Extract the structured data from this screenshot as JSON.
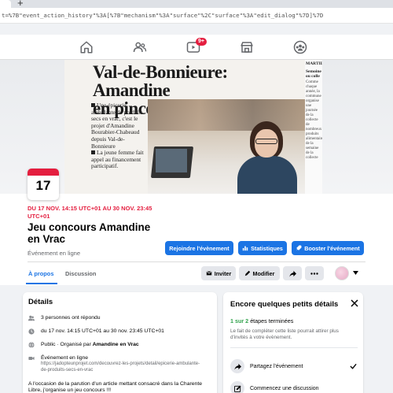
{
  "browser": {
    "new_tab": "+",
    "url": "t=%7B\"event_action_history\"%3A[%7B\"mechanism\"%3A\"surface\"%2C\"surface\"%3A\"edit_dialog\"%7D]%7D"
  },
  "fb_nav": {
    "items": [
      "home-icon",
      "friends-icon",
      "watch-icon",
      "marketplace-icon",
      "groups-icon"
    ],
    "watch_badge": "9+"
  },
  "cover": {
    "headline_line1": "Val-de-Bonnieure: Amandine",
    "headline_line2": "en pince pour le vrac",
    "caption": "Une épicerie ambulante de produits secs en vrac, c'est le projet d'Amandine Bourabier-Chabeaud depuis Val-de-Bonnieure",
    "caption2": "La jeune femme fait appel au financement participatif.",
    "side_head": "MARTIL",
    "side_head2": "Semoine ou colle",
    "side_text": "Comme chaque année, la commune organise une journée de la collecte de nombreux produits alimentaires de la semaine de la collecte"
  },
  "event": {
    "day": "17",
    "date_line": "DU 17 NOV. 14:15 UTC+01 AU 30 NOV. 23:45 UTC+01",
    "title": "Jeu concours Amandine en Vrac",
    "subtitle": "Événement en ligne"
  },
  "actions": {
    "join": "Rejoindre l'évènement",
    "stats": "Statistiques",
    "boost": "Booster l'événement",
    "invite": "Inviter",
    "edit": "Modifier"
  },
  "tabs": {
    "about": "À propos",
    "discussion": "Discussion"
  },
  "details": {
    "title": "Détails",
    "responded": "3 personnes ont répondu",
    "dates": "du 17 nov. 14:15 UTC+01 au 30 nov. 23:45 UTC+01",
    "public_prefix": "Public · Organisé par",
    "organizer": "Amandine en Vrac",
    "online_label": "Événement en ligne",
    "online_url": "https://jadopteunprojet.com/decouvrez-les-projets/detail/epicerie-ambulante-de-produits-secs-en-vrac",
    "description": "A l'occasion de la parution d'un article mettant consacré dans la Charente Libre, j'organise un jeu concours !!!"
  },
  "checklist": {
    "title": "Encore quelques petits détails",
    "progress_done": "1 sur 2",
    "progress_rest": "étapes terminées",
    "hint": "Le fait de compléter cette liste pourrait attirer plus d'invités à votre évènement.",
    "step1": "Partagez l'événement",
    "step2": "Commencez une discussion"
  },
  "colors": {
    "accent": "#1b74e4",
    "date_red": "#e41e3f",
    "success": "#31a24c"
  }
}
